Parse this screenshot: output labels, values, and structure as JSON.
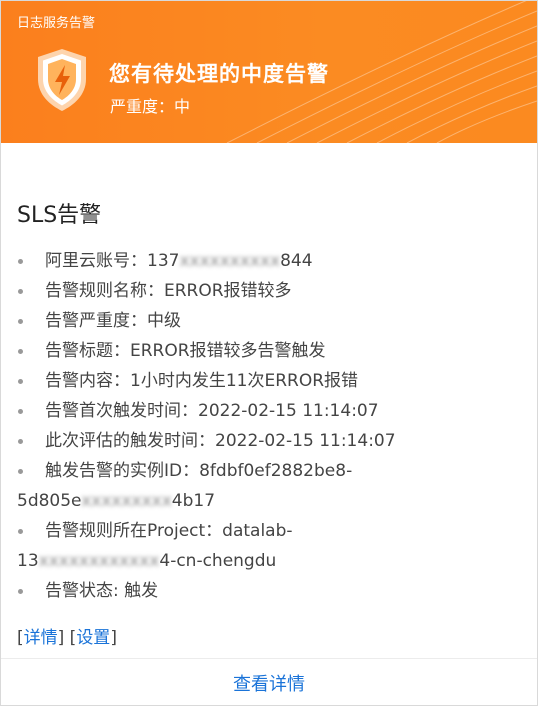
{
  "header": {
    "app_name": "日志服务告警",
    "title": "您有待处理的中度告警",
    "severity_label": "严重度：",
    "severity_value": "中",
    "accent_color": "#fb8520"
  },
  "section_title": "SLS告警",
  "items": [
    {
      "label": "阿里云账号：",
      "value_prefix": "137",
      "value_blurred": "xxxxxxxxxx",
      "value_suffix": "844"
    },
    {
      "label": "告警规则名称：",
      "value": "ERROR报错较多"
    },
    {
      "label": "告警严重度：",
      "value": "中级"
    },
    {
      "label": "告警标题：",
      "value": "ERROR报错较多告警触发"
    },
    {
      "label": "告警内容：",
      "value": "1小时内发生11次ERROR报错"
    },
    {
      "label": "告警首次触发时间：",
      "value": "2022-02-15 11:14:07"
    },
    {
      "label": "此次评估的触发时间：",
      "value": "2022-02-15 11:14:07"
    },
    {
      "label": "触发告警的实例ID：",
      "value_line1": "8fdbf0ef2882be8-",
      "value_prefix": "5d805e",
      "value_blurred": "xxxxxxxxx",
      "value_suffix": "4b17"
    },
    {
      "label": "告警规则所在Project：",
      "value_line1": "datalab-",
      "value_prefix": "13",
      "value_blurred": "xxxxxxxxxxxx",
      "value_suffix": "4-cn-chengdu"
    },
    {
      "label": "告警状态: ",
      "value": "触发"
    }
  ],
  "links": {
    "details": "详情",
    "settings": "设置"
  },
  "footer": {
    "view_details": "查看详情"
  }
}
